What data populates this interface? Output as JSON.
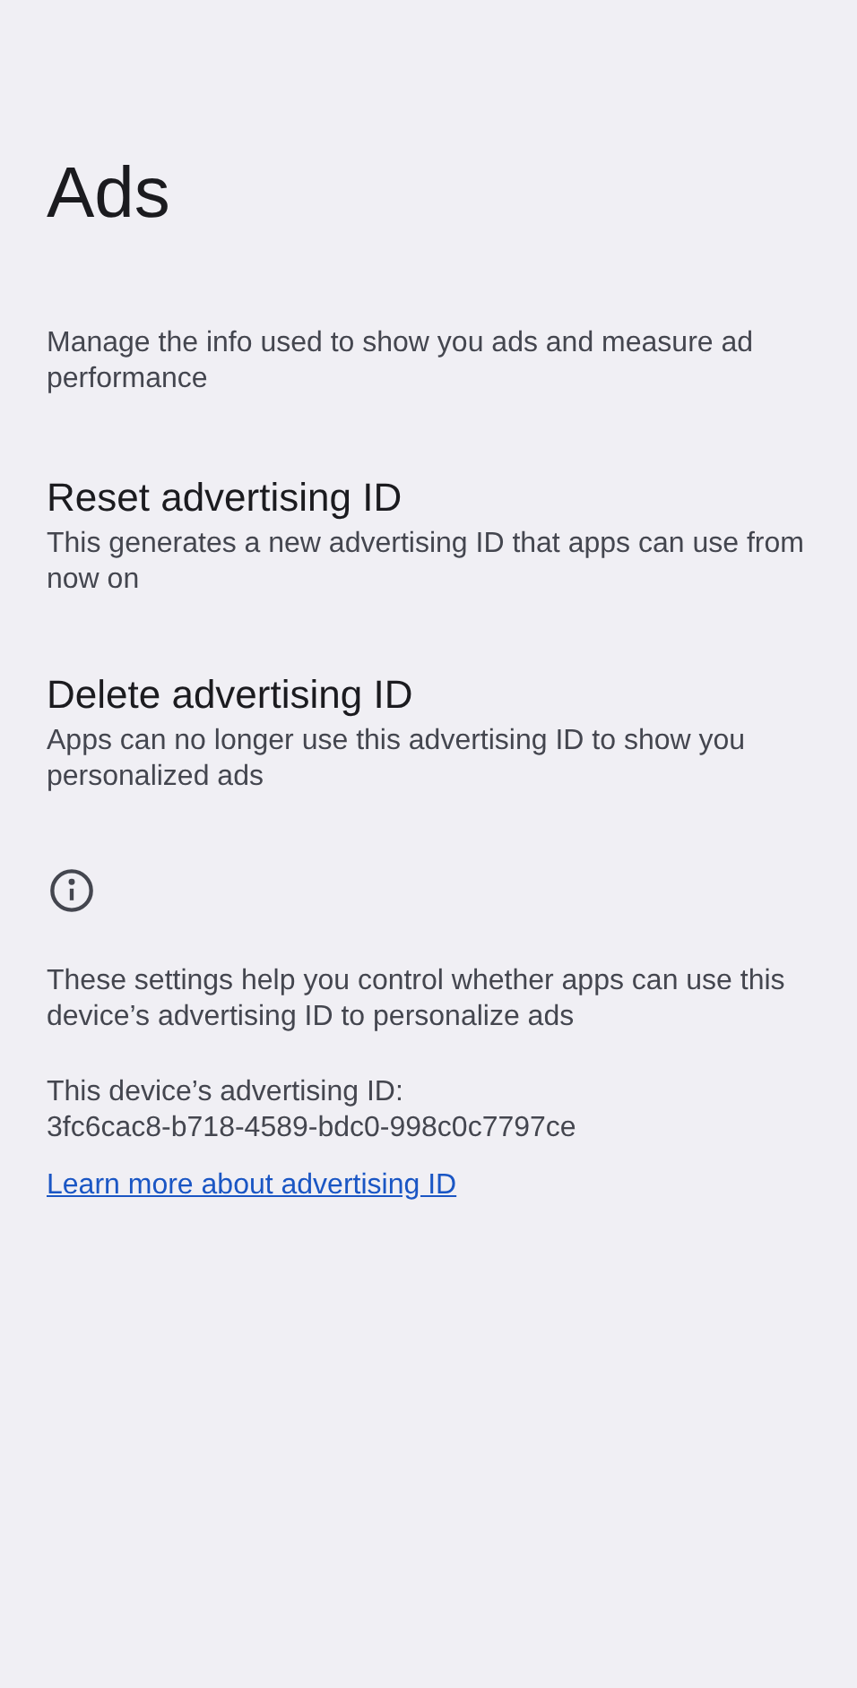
{
  "title": "Ads",
  "description": "Manage the info used to show you ads and measure ad performance",
  "items": [
    {
      "title": "Reset advertising ID",
      "summary": "This generates a new advertising ID that apps can use from now on"
    },
    {
      "title": "Delete advertising ID",
      "summary": "Apps can no longer use this advertising ID to show you personalized ads"
    }
  ],
  "footer": {
    "info": "These settings help you control whether apps can use this device’s advertising ID to personalize ads",
    "id_label": "This device’s advertising ID:",
    "id_value": "3fc6cac8-b718-4589-bdc0-998c0c7797ce",
    "link": "Learn more about advertising ID"
  }
}
